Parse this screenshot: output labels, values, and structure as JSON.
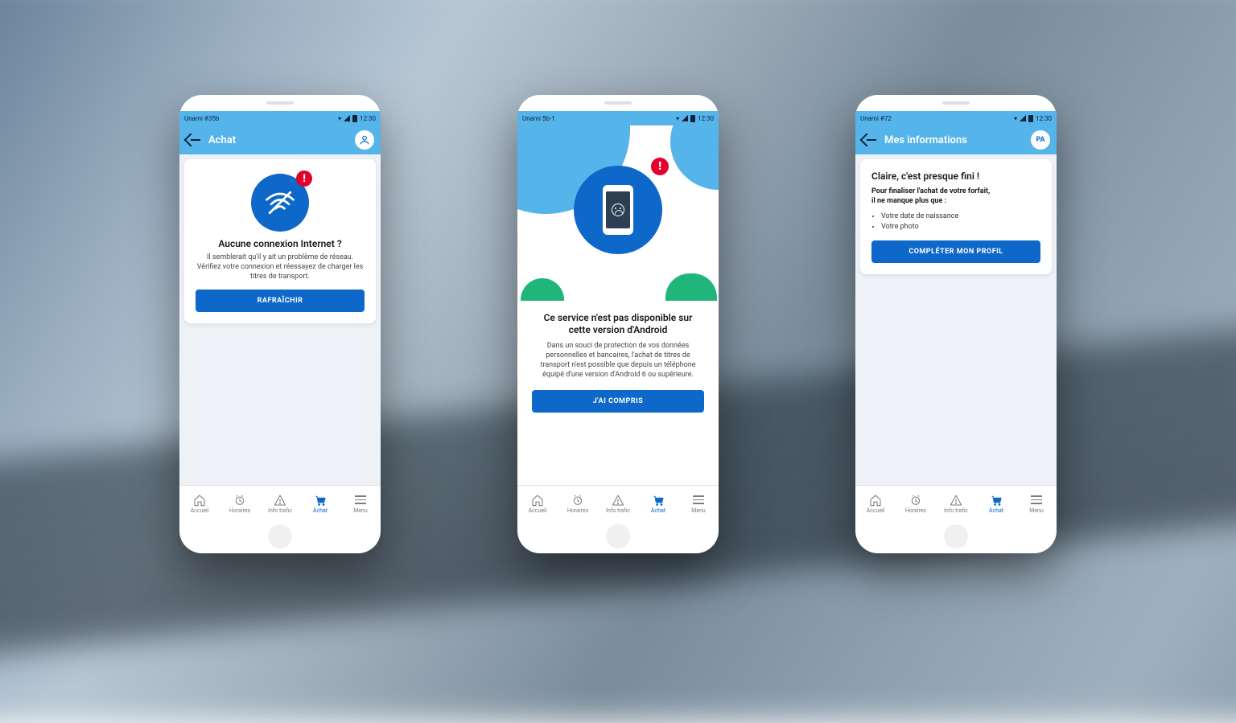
{
  "status_time": "12:30",
  "screens": [
    {
      "device_label": "Unami #35b",
      "app_bar": {
        "title": "Achat",
        "has_back": true,
        "avatar_mode": "icon"
      },
      "card": {
        "title": "Aucune connexion Internet ?",
        "body": "Il semblerait qu'il y ait un problème de réseau. Vérifiez votre connexion et réessayez de charger les titres de transport.",
        "button": "RAFRAÎCHIR"
      }
    },
    {
      "device_label": "Unami 5b-1",
      "section": {
        "title": "Ce service n'est pas disponible sur cette version d'Android",
        "body": "Dans un souci de protection de vos données personnelles et bancaires, l'achat de titres de transport n'est possible que depuis un téléphone équipé d'une version d'Android 6 ou supérieure.",
        "button": "J'AI COMPRIS"
      }
    },
    {
      "device_label": "Unami #72",
      "app_bar": {
        "title": "Mes informations",
        "has_back": true,
        "avatar_mode": "initials",
        "initials": "PA"
      },
      "card": {
        "title": "Claire, c'est presque fini !",
        "subtitle": "Pour finaliser l'achat de votre forfait,\nil ne manque plus que :",
        "bullets": [
          "Votre date de naissance",
          "Votre photo"
        ],
        "button": "COMPLÉTER MON PROFIL"
      }
    }
  ],
  "bottom_nav": [
    {
      "key": "accueil",
      "label": "Accueil",
      "icon": "home-icon",
      "active": false
    },
    {
      "key": "horaires",
      "label": "Horaires",
      "icon": "clock-icon",
      "active": false
    },
    {
      "key": "info-trafic",
      "label": "Info trafic",
      "icon": "warning-icon",
      "active": false
    },
    {
      "key": "achat",
      "label": "Achat",
      "icon": "cart-icon",
      "active": true
    },
    {
      "key": "menu",
      "label": "Menu",
      "icon": "menu-icon",
      "active": false
    }
  ],
  "colors": {
    "primary": "#0e68c9",
    "accent": "#55b4ea",
    "alert": "#e4002b",
    "success": "#20b679"
  }
}
